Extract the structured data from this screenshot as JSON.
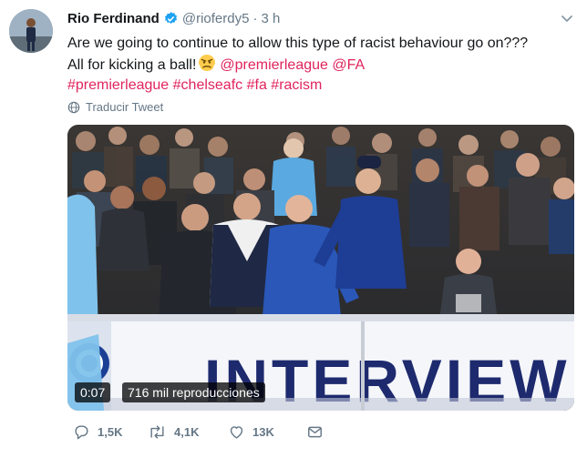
{
  "tweet": {
    "display_name": "Rio Ferdinand",
    "handle": "@rioferdy5",
    "separator": "·",
    "time": "3 h",
    "text_line1": "Are we going to continue to allow this type of racist behaviour go on???",
    "text_line2_prefix": "All for kicking a ball!",
    "emoji": "angry-face",
    "mentions": [
      "@premierleague",
      "@FA"
    ],
    "hashtags": [
      "#premierleague",
      "#chelseafc",
      "#fa",
      "#racism"
    ],
    "translate_label": "Traducir Tweet"
  },
  "video": {
    "duration": "0:07",
    "views": "716 mil reproducciones",
    "board_text": "INTERVIEW"
  },
  "actions": {
    "reply_count": "1,5K",
    "retweet_count": "4,1K",
    "like_count": "13K"
  },
  "colors": {
    "link": "#e0245e",
    "secondary": "#657786",
    "verified": "#1da1f2"
  }
}
